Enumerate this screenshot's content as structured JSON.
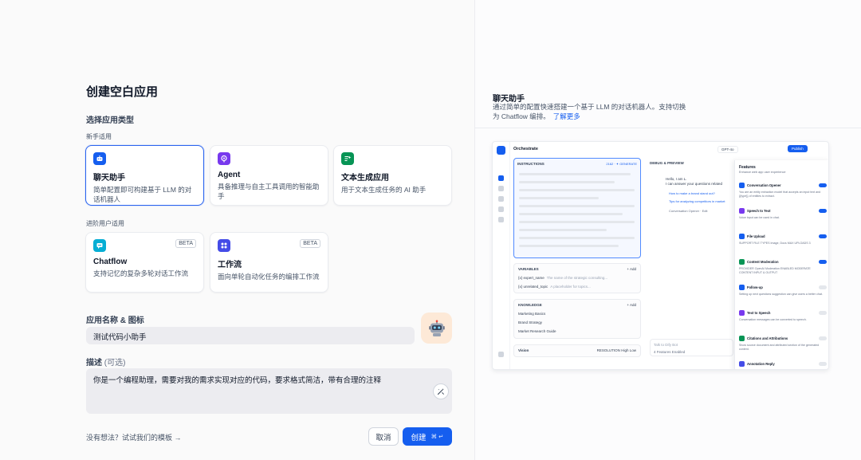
{
  "dialog": {
    "title": "创建空白应用",
    "select_type_title": "选择应用类型",
    "beginner_label": "新手适用",
    "advanced_label": "进阶用户适用",
    "beginner_types": [
      {
        "name": "聊天助手",
        "desc": "简单配置即可构建基于 LLM 的对话机器人",
        "icon": "chat-bot-icon",
        "color": "#155eef",
        "selected": true
      },
      {
        "name": "Agent",
        "desc": "具备推理与自主工具调用的智能助手",
        "icon": "agent-icon",
        "color": "#7839ee",
        "selected": false
      },
      {
        "name": "文本生成应用",
        "desc": "用于文本生成任务的 AI 助手",
        "icon": "text-generation-icon",
        "color": "#079455",
        "selected": false
      }
    ],
    "advanced_types": [
      {
        "name": "Chatflow",
        "desc": "支持记忆的复杂多轮对话工作流",
        "badge": "BETA",
        "icon": "chatflow-icon",
        "color": "#06aed4"
      },
      {
        "name": "工作流",
        "desc": "面向单轮自动化任务的编排工作流",
        "badge": "BETA",
        "icon": "workflow-icon",
        "color": "#444ce7"
      }
    ],
    "name_icon_label": "应用名称 & 图标",
    "name_value": "测试代码小助手",
    "app_icon": "robot-emoji-icon",
    "desc_label": "描述",
    "desc_optional": "(可选)",
    "desc_value": "你是一个编程助理，需要对我的需求实现对应的代码，要求格式简洁，带有合理的注释",
    "template_link": "没有想法？试试我们的模板",
    "cancel_label": "取消",
    "create_label": "创建",
    "create_shortcut": "⌘ ↵"
  },
  "preview": {
    "title": "聊天助手",
    "desc": "通过简单的配置快速搭建一个基于 LLM 的对话机器人。支持切换为 Chatflow 编排。",
    "learn_more": "了解更多",
    "orchestrate": "Orchestrate",
    "model": "GPT-4o",
    "publish": "Publish",
    "instructions": "INSTRUCTIONS",
    "instructions_count": "2162",
    "generate": "GENERATE",
    "variables": "VARIABLES",
    "add": "+ Add",
    "variable_rows": [
      {
        "name": "{x} expert_name",
        "desc": "The name of the strategic consulting...",
        "type": "String"
      },
      {
        "name": "{x} unrelated_topic",
        "desc": "A placeholder for topics...",
        "type": "String"
      }
    ],
    "knowledge": "KNOWLEDGE",
    "recall": "Recall Settings",
    "knowledge_rows": [
      "Marketing Basics",
      "Brand Strategy",
      "Market Research Guide"
    ],
    "vision": "Vision",
    "resolution": "RESOLUTION",
    "high": "High",
    "low": "Low",
    "debug": "DEBUG & PREVIEW",
    "greeting": "Hello, I am L.",
    "greeting2": "I can answer your questions related",
    "suggestions": [
      "How to make a brand stand out?",
      "Tips for analyzing competitors in market"
    ],
    "opener": "Conversation Opener",
    "edit": "Edit",
    "talk": "Talk to Dify Bot",
    "features_enabled": "4 Features Enabled",
    "features_title": "Features",
    "features_sub": "Enhance web app user experience",
    "features": [
      {
        "name": "Conversation Opener",
        "desc": "You are an entity extraction model that accepts an input text and {{type}} of entities to extract.",
        "color": "#155eef",
        "on": true
      },
      {
        "name": "Speech to Text",
        "desc": "Voice input can be used in chat.",
        "color": "#7839ee",
        "on": true
      },
      {
        "name": "File Upload",
        "desc": "SUPPORT FILE TYPES Image, Docs   MAX UPLOADS 3",
        "color": "#155eef",
        "on": true
      },
      {
        "name": "Content Moderation",
        "desc": "PROVIDER OpenAI Moderation   ENABLED MODERATE CONTENT INPUT & OUTPUT",
        "color": "#079455",
        "on": true
      },
      {
        "name": "Follow-up",
        "desc": "Setting up next questions suggestion can give users a better chat.",
        "color": "#155eef",
        "on": false
      },
      {
        "name": "Text to Speech",
        "desc": "Conversation messages can be converted to speech.",
        "color": "#7839ee",
        "on": false
      },
      {
        "name": "Citations and Attributions",
        "desc": "Show source document and attributed section of the generated content.",
        "color": "#079455",
        "on": false
      },
      {
        "name": "Annotation Reply",
        "desc": "",
        "color": "#444ce7",
        "on": false
      }
    ]
  }
}
